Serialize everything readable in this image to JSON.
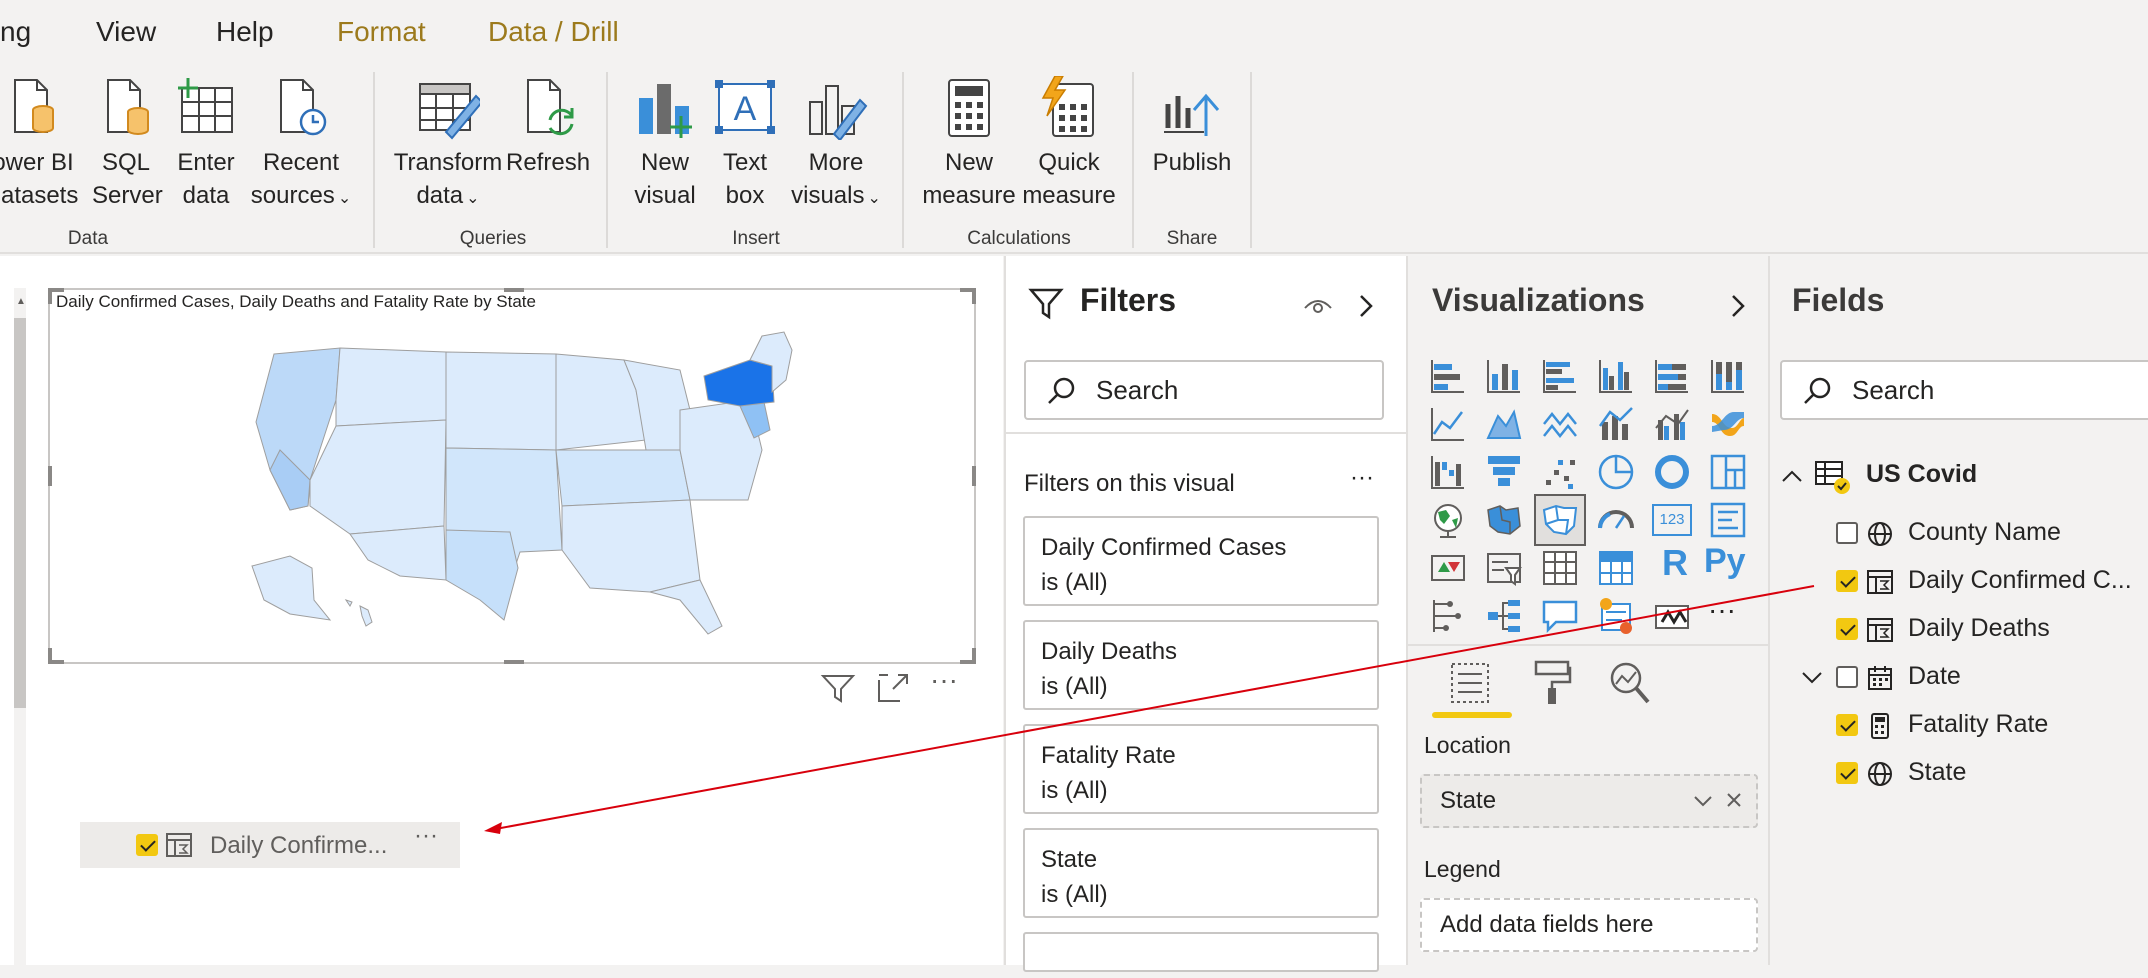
{
  "menu": {
    "items": [
      "ng",
      "View",
      "Help",
      "Format",
      "Data / Drill"
    ]
  },
  "ribbon": {
    "buttons": {
      "power_bi_datasets": [
        "ower BI",
        "datasets"
      ],
      "sql_server": [
        "SQL",
        "Server"
      ],
      "enter_data": [
        "Enter",
        "data"
      ],
      "recent_sources": [
        "Recent",
        "sources"
      ],
      "transform_data": [
        "Transform",
        "data"
      ],
      "refresh": [
        "Refresh"
      ],
      "new_visual": [
        "New",
        "visual"
      ],
      "text_box": [
        "Text",
        "box"
      ],
      "more_visuals": [
        "More",
        "visuals"
      ],
      "new_measure": [
        "New",
        "measure"
      ],
      "quick_measure": [
        "Quick",
        "measure"
      ],
      "publish": [
        "Publish"
      ]
    },
    "groups": [
      "Data",
      "Queries",
      "Insert",
      "Calculations",
      "Share"
    ]
  },
  "canvas": {
    "visual_title": "Daily Confirmed Cases, Daily Deaths and Fatality Rate by State",
    "drag_item_label": "Daily Confirme...",
    "more_label": "···"
  },
  "filters": {
    "title": "Filters",
    "search_placeholder": "Search",
    "section_label": "Filters on this visual",
    "more_label": "···",
    "cards": [
      {
        "field": "Daily Confirmed Cases",
        "condition": "is (All)"
      },
      {
        "field": "Daily Deaths",
        "condition": "is (All)"
      },
      {
        "field": "Fatality Rate",
        "condition": "is (All)"
      },
      {
        "field": "State",
        "condition": "is (All)"
      }
    ]
  },
  "visualizations": {
    "title": "Visualizations",
    "r_label": "R",
    "py_label": "Py",
    "kpi_label": "123",
    "more_label": "···",
    "location_label": "Location",
    "location_value": "State",
    "legend_label": "Legend",
    "legend_placeholder": "Add data fields here"
  },
  "fields": {
    "title": "Fields",
    "search_placeholder": "Search",
    "table_name": "US Covid",
    "items": [
      {
        "label": "County Name",
        "checked": false,
        "icon": "globe-icon"
      },
      {
        "label": "Daily Confirmed C...",
        "checked": true,
        "icon": "measure-table-icon"
      },
      {
        "label": "Daily Deaths",
        "checked": true,
        "icon": "measure-table-icon"
      },
      {
        "label": "Date",
        "checked": false,
        "icon": "calendar-icon"
      },
      {
        "label": "Fatality Rate",
        "checked": true,
        "icon": "calculator-icon"
      },
      {
        "label": "State",
        "checked": true,
        "icon": "globe-icon"
      }
    ]
  },
  "colors": {
    "accent_yellow": "#f2c811",
    "ribbon_bg": "#f3f2f1",
    "map_highlight": "#1a73e8",
    "drag_arrow": "#d8000c"
  }
}
